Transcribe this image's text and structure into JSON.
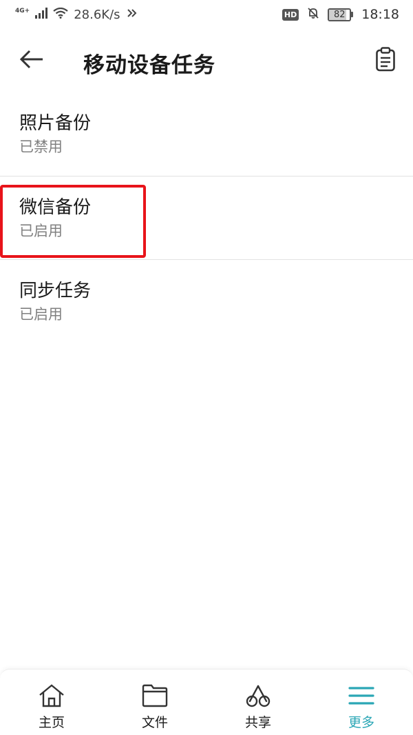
{
  "status_bar": {
    "network": "4G+",
    "speed": "28.6K/s",
    "hd_badge": "HD",
    "battery": "82",
    "battery_level": 0.82,
    "time": "18:18"
  },
  "app_bar": {
    "title": "移动设备任务"
  },
  "tasks": [
    {
      "title": "照片备份",
      "status": "已禁用"
    },
    {
      "title": "微信备份",
      "status": "已启用"
    },
    {
      "title": "同步任务",
      "status": "已启用"
    }
  ],
  "bottom_nav": {
    "items": [
      {
        "label": "主页",
        "icon": "home-icon"
      },
      {
        "label": "文件",
        "icon": "folder-icon"
      },
      {
        "label": "共享",
        "icon": "share-icon"
      },
      {
        "label": "更多",
        "icon": "menu-icon"
      }
    ],
    "active_index": 3,
    "accent_color": "#2aa6b5"
  }
}
